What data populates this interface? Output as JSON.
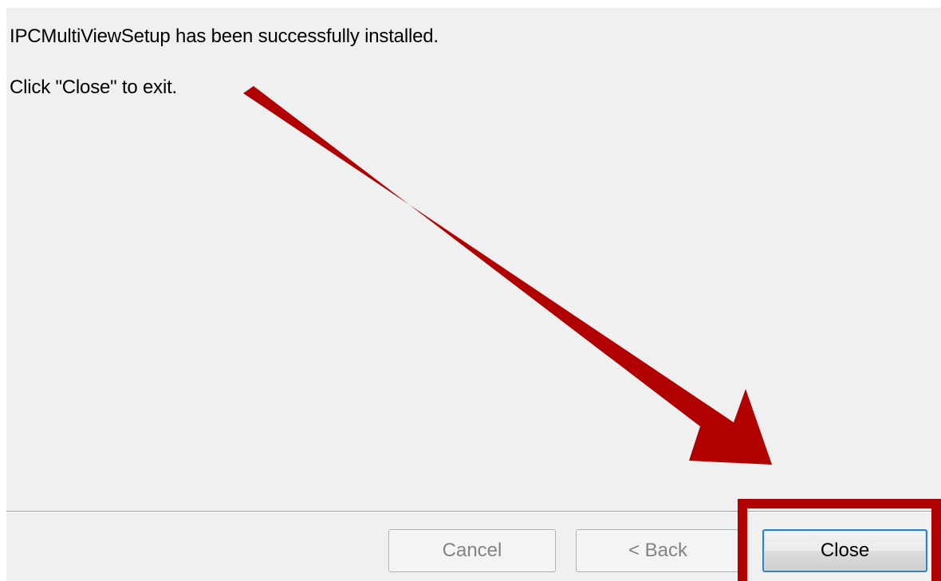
{
  "message": {
    "line1": "IPCMultiViewSetup has been successfully installed.",
    "line2": "Click \"Close\" to exit."
  },
  "buttons": {
    "cancel_label": "Cancel",
    "back_label": "< Back",
    "close_label": "Close"
  },
  "annotation": {
    "arrow_color": "#b00000",
    "highlight_color": "#b00000",
    "points_to": "close-button"
  },
  "colors": {
    "dialog_background": "#f0f0f0",
    "close_button_border": "#3c7fb1"
  }
}
